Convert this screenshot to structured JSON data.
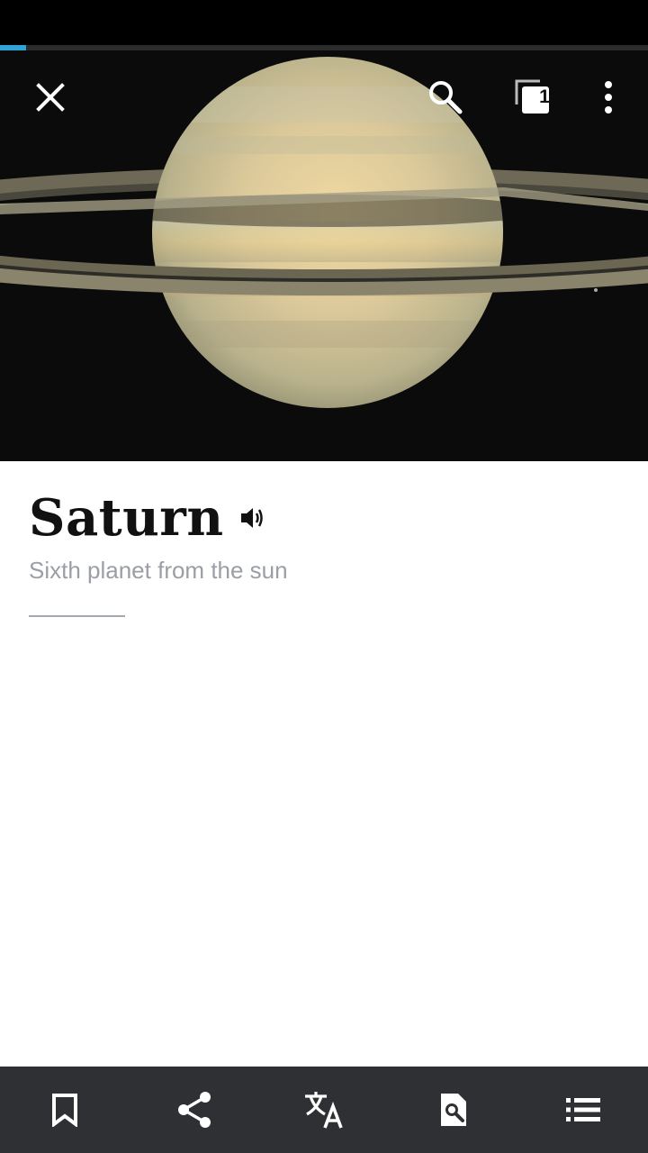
{
  "app": {
    "load_progress": 0.04,
    "accent_color": "#2ea3d8",
    "toolbar_bg": "#2f3033"
  },
  "toolbar": {
    "close_icon": "close-icon",
    "search_icon": "search-icon",
    "tabs_count": "1",
    "overflow_icon": "more-vertical-icon"
  },
  "article": {
    "title": "Saturn",
    "description": "Sixth planet from the sun",
    "lead_image": "Saturn planet with rings",
    "audio_icon": "volume-icon"
  },
  "bottom_bar": {
    "items": [
      {
        "icon": "bookmark-icon"
      },
      {
        "icon": "share-icon"
      },
      {
        "icon": "translate-icon"
      },
      {
        "icon": "find-in-page-icon"
      },
      {
        "icon": "table-of-contents-icon"
      }
    ]
  }
}
